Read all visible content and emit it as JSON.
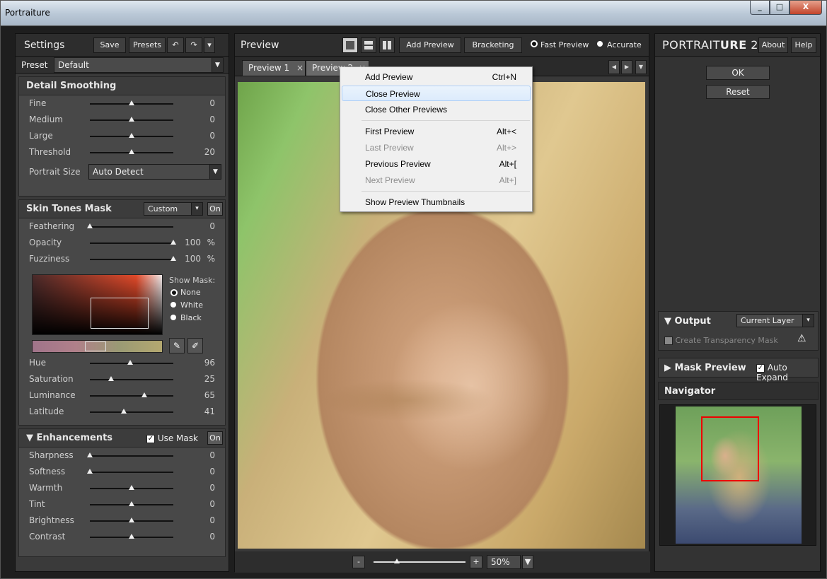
{
  "window": {
    "title": "Portraiture",
    "controls": [
      "_",
      "□",
      "X"
    ]
  },
  "left": {
    "title": "Settings",
    "save": "Save",
    "presets": "Presets",
    "undo": "↶",
    "redo": "↷",
    "menu_arrow": "▾",
    "preset_label": "Preset",
    "preset_value": "Default",
    "detail": {
      "title": "Detail Smoothing",
      "rows": [
        {
          "name": "Fine",
          "value": "0",
          "pos": 0.5
        },
        {
          "name": "Medium",
          "value": "0",
          "pos": 0.5
        },
        {
          "name": "Large",
          "value": "0",
          "pos": 0.5
        },
        {
          "name": "Threshold",
          "value": "20",
          "pos": 0.5
        }
      ],
      "portrait_size_label": "Portrait Size",
      "portrait_size_value": "Auto Detect"
    },
    "skin": {
      "title": "Skin Tones Mask",
      "mode": "Custom",
      "on": "On",
      "rows": [
        {
          "name": "Feathering",
          "value": "0",
          "pos": 0.0
        },
        {
          "name": "Opacity",
          "value": "100",
          "unit": "%",
          "pos": 1.0
        },
        {
          "name": "Fuzziness",
          "value": "100",
          "unit": "%",
          "pos": 1.0
        }
      ],
      "show_mask_label": "Show Mask:",
      "mask_options": [
        "None",
        "White",
        "Black"
      ],
      "mask_selected": "None",
      "hsl": [
        {
          "name": "Hue",
          "value": "96",
          "pos": 0.48
        },
        {
          "name": "Saturation",
          "value": "25",
          "pos": 0.25
        },
        {
          "name": "Luminance",
          "value": "65",
          "pos": 0.65
        },
        {
          "name": "Latitude",
          "value": "41",
          "pos": 0.41
        }
      ]
    },
    "enh": {
      "title": "Enhancements",
      "use_mask": "Use Mask",
      "on": "On",
      "rows": [
        {
          "name": "Sharpness",
          "value": "0",
          "pos": 0.0
        },
        {
          "name": "Softness",
          "value": "0",
          "pos": 0.0
        },
        {
          "name": "Warmth",
          "value": "0",
          "pos": 0.5
        },
        {
          "name": "Tint",
          "value": "0",
          "pos": 0.5
        },
        {
          "name": "Brightness",
          "value": "0",
          "pos": 0.5
        },
        {
          "name": "Contrast",
          "value": "0",
          "pos": 0.5
        }
      ]
    }
  },
  "center": {
    "title": "Preview",
    "add_preview": "Add Preview",
    "bracketing": "Bracketing",
    "fast_preview": "Fast Preview",
    "accurate": "Accurate",
    "tabs": [
      {
        "label": "Preview 1",
        "close": "×"
      },
      {
        "label": "Preview 2",
        "close": "×"
      }
    ],
    "zoom_minus": "-",
    "zoom_plus": "+",
    "zoom": "50%",
    "zoom_pos": 0.25
  },
  "menu": {
    "items": [
      {
        "label": "Add Preview",
        "shortcut": "Ctrl+N",
        "disabled": false,
        "highlighted": false
      },
      {
        "label": "Close Preview",
        "shortcut": "",
        "disabled": false,
        "highlighted": true
      },
      {
        "label": "Close Other Previews",
        "shortcut": "",
        "disabled": false,
        "highlighted": false
      },
      {
        "label": "First Preview",
        "shortcut": "Alt+<",
        "disabled": false,
        "highlighted": false
      },
      {
        "label": "Last Preview",
        "shortcut": "Alt+>",
        "disabled": true,
        "highlighted": false
      },
      {
        "label": "Previous Preview",
        "shortcut": "Alt+[",
        "disabled": false,
        "highlighted": false
      },
      {
        "label": "Next Preview",
        "shortcut": "Alt+]",
        "disabled": true,
        "highlighted": false
      },
      {
        "label": "Show Preview Thumbnails",
        "shortcut": "",
        "disabled": false,
        "highlighted": false
      }
    ]
  },
  "right": {
    "brand_a": "PORTRAIT",
    "brand_b": "URE",
    "brand_c": " 2",
    "about": "About",
    "help": "Help",
    "ok": "OK",
    "reset": "Reset",
    "output_label": "Output",
    "output_value": "Current Layer",
    "transparency": "Create Transparency Mask",
    "warn": "⚠",
    "mask_preview": "Mask Preview",
    "auto_expand": "Auto Expand",
    "navigator": "Navigator"
  }
}
